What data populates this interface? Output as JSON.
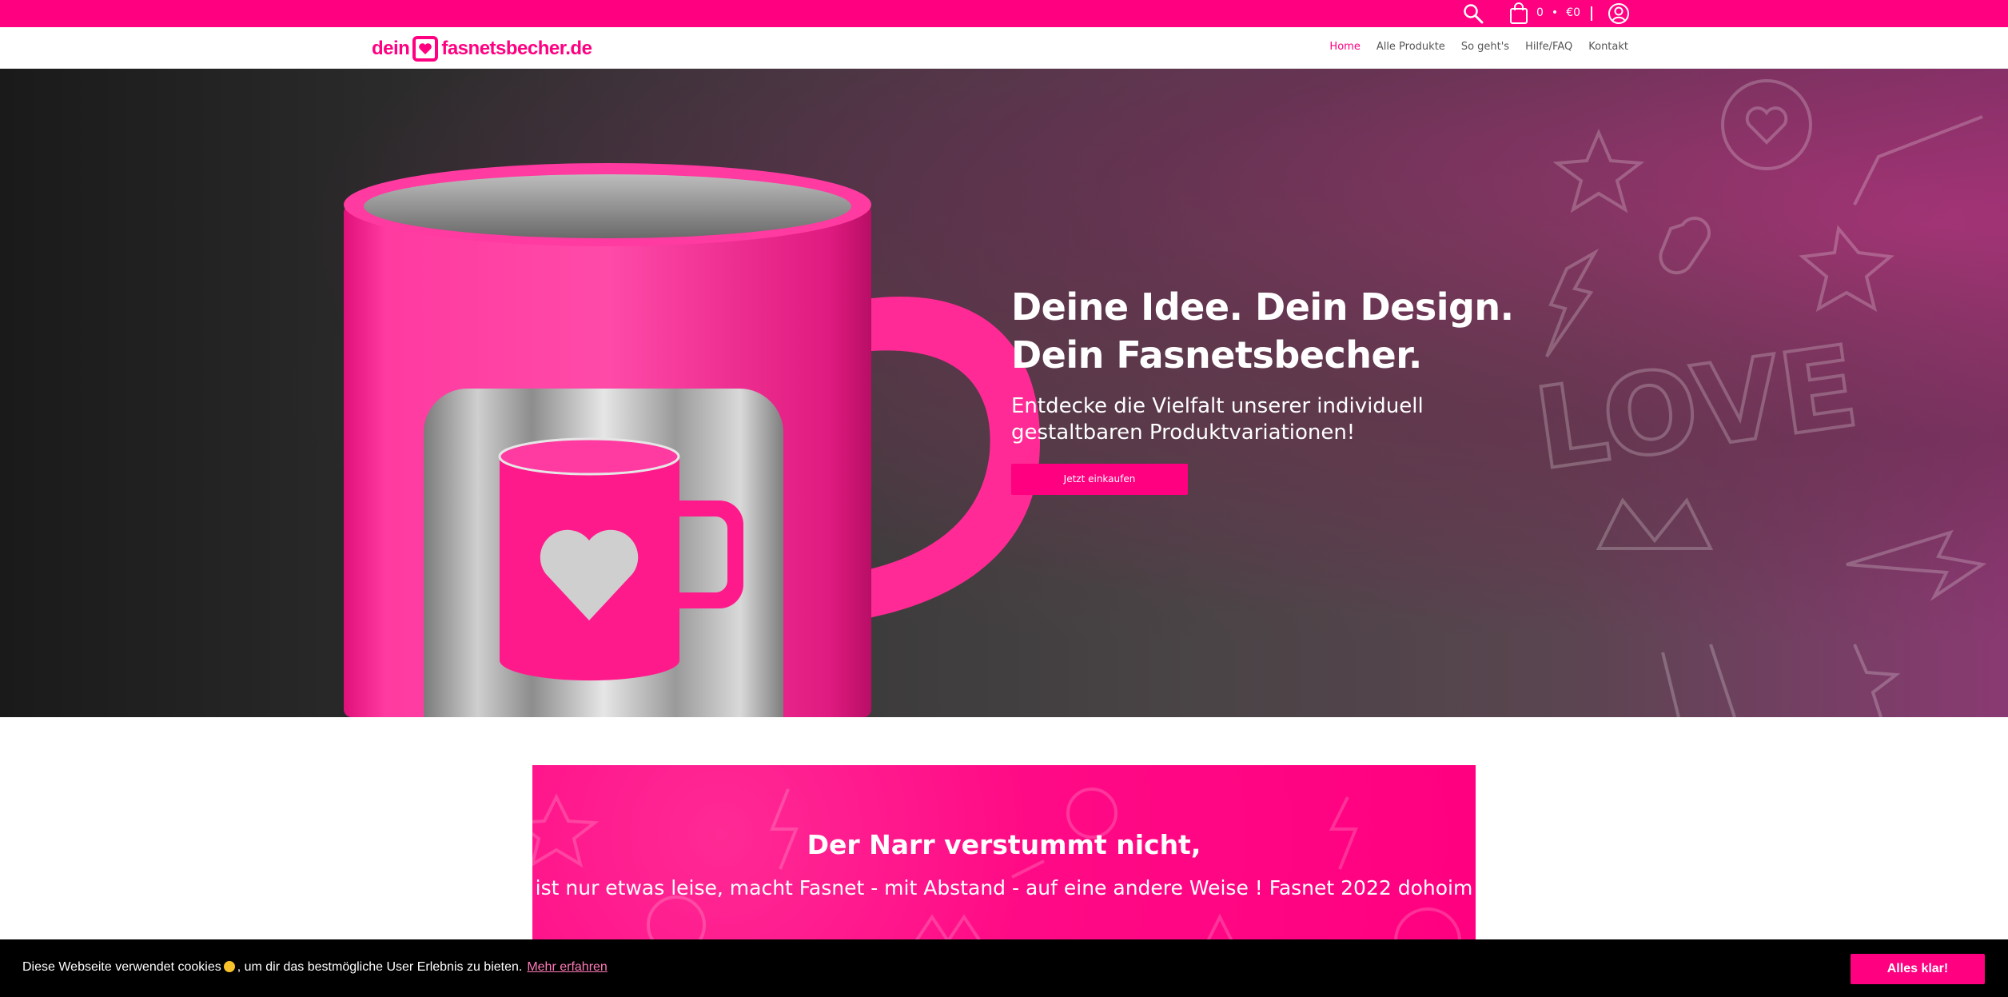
{
  "topbar": {
    "cart_count": "0",
    "cart_separator": "•",
    "cart_total": "€0"
  },
  "logo": {
    "word1": "dein",
    "word2": "fasnetsbecher.de"
  },
  "nav": {
    "items": [
      {
        "label": "Home",
        "active": true
      },
      {
        "label": "Alle Produkte",
        "active": false
      },
      {
        "label": "So geht's",
        "active": false
      },
      {
        "label": "Hilfe/FAQ",
        "active": false
      },
      {
        "label": "Kontakt",
        "active": false
      }
    ]
  },
  "hero": {
    "headline_line1": "Deine Idee. Dein Design.",
    "headline_line2": "Dein Fasnetsbecher.",
    "subline": "Entdecke die Vielfalt unserer individuell gestaltbaren Produktvariationen!",
    "button_label": "Jetzt einkaufen",
    "doodle_text": "LOVE"
  },
  "banner": {
    "title": "Der Narr verstummt nicht,",
    "text": "ist nur etwas leise, macht Fasnet - mit Abstand - auf eine andere Weise ! Fasnet 2022 dohoim"
  },
  "cookie": {
    "text_before": "Diese Webseite verwendet cookies",
    "text_after": ", um dir das bestmögliche User Erlebnis zu bieten.",
    "more_link": "Mehr erfahren",
    "accept_label": "Alles klar!"
  },
  "colors": {
    "brand_pink": "#ff0080",
    "cookie_bg": "#000000"
  }
}
